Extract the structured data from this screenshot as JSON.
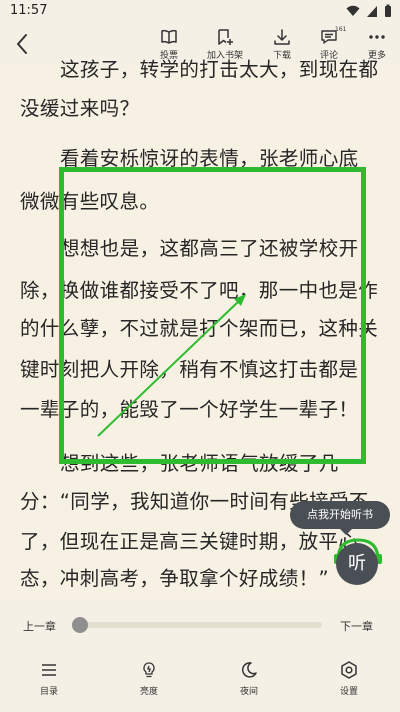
{
  "status_bar": {
    "time": "11:57"
  },
  "toolbar": {
    "back_icon": "chevron-left-icon",
    "items": [
      {
        "label": "投票",
        "icon": "book-icon"
      },
      {
        "label": "加入书架",
        "icon": "bookmark-add-icon"
      },
      {
        "label": "下载",
        "icon": "download-icon"
      },
      {
        "label": "评论",
        "icon": "comment-icon",
        "badge": "161"
      },
      {
        "label": "更多",
        "icon": "more-icon"
      }
    ]
  },
  "content": {
    "lines": [
      "这孩子，转学的打击太大，到现在都",
      "没缓过来吗？",
      "看着安栎惊讶的表情，张老师心底",
      "微微有些叹息。",
      "想想也是，这都高三了还被学校开",
      "除，换做谁都接受不了吧，那一中也是作",
      "的什么孽，不过就是打个架而已，这种关",
      "键时刻把人开除，稍有不慎这打击都是",
      "一辈子的，能毁了一个好学生一辈子！",
      "想到这些，张老师语气放缓了几",
      "分：“同学，我知道你一时间有些接受不",
      "了，但现在正是高三关键时期，放平心",
      "态，冲刺高考，争取拿个好成绩！”"
    ]
  },
  "listen": {
    "tooltip": "点我开始听书",
    "button_label": "听"
  },
  "progress": {
    "prev_chapter": "上一章",
    "next_chapter": "下一章",
    "value": 0.03
  },
  "bottom_nav": {
    "items": [
      {
        "label": "目录",
        "icon": "list-icon"
      },
      {
        "label": "亮度",
        "icon": "brightness-icon"
      },
      {
        "label": "夜间",
        "icon": "moon-icon"
      },
      {
        "label": "设置",
        "icon": "settings-icon"
      }
    ]
  },
  "colors": {
    "background": "#f7f1e3",
    "annotation": "#2fbb2f",
    "listen_button": "#4a4e55"
  }
}
